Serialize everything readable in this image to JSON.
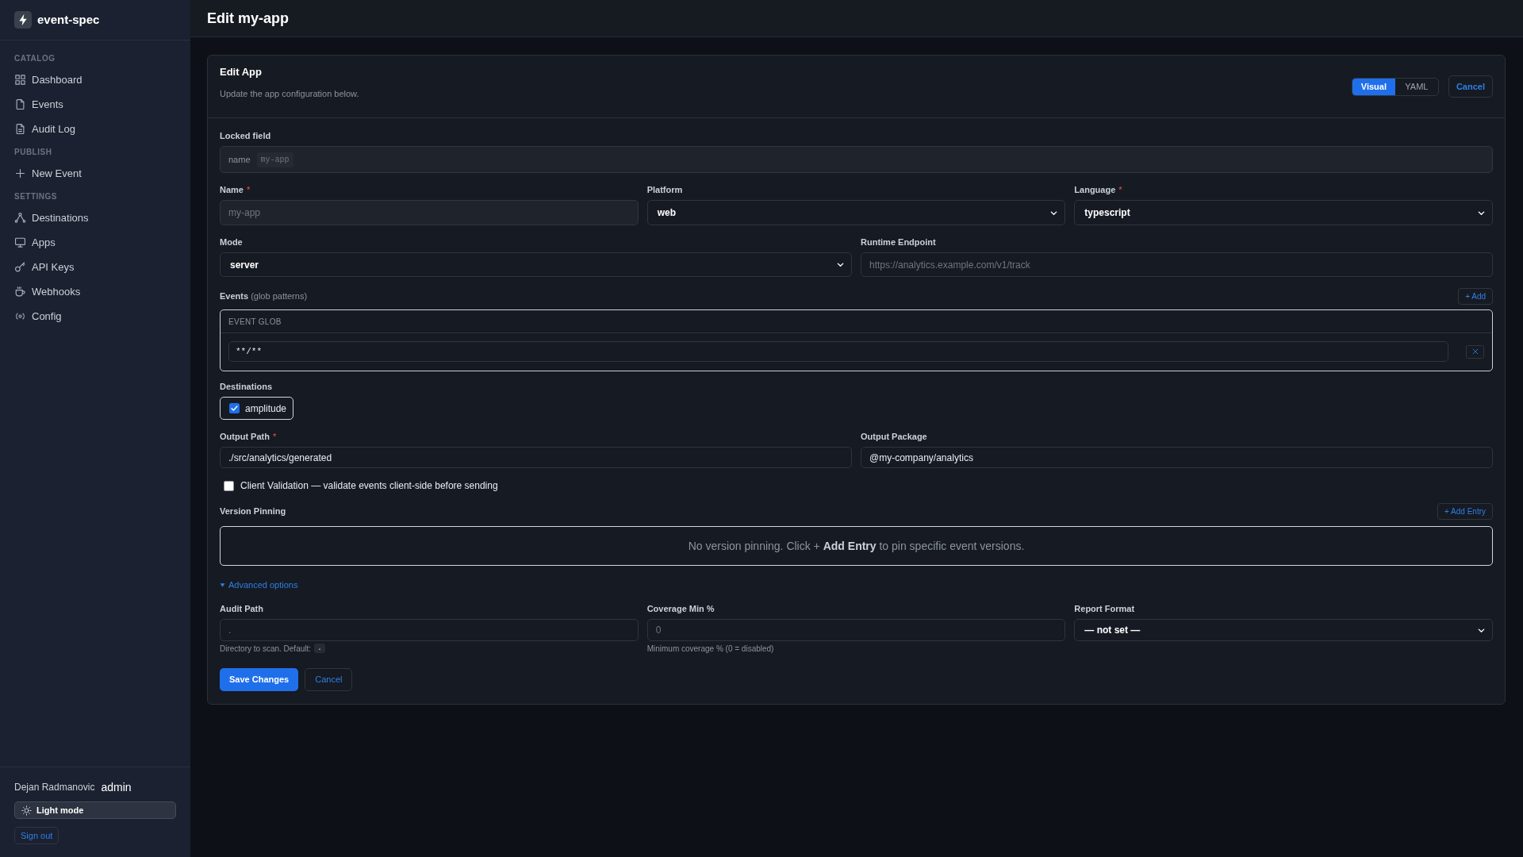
{
  "sidebar": {
    "brand": "event-spec",
    "sections": [
      {
        "label": "CATALOG",
        "items": [
          {
            "label": "Dashboard",
            "selected": false
          },
          {
            "label": "Events",
            "selected": false
          },
          {
            "label": "Audit Log",
            "selected": false
          }
        ]
      },
      {
        "label": "PUBLISH",
        "items": [
          {
            "label": "New Event",
            "selected": false
          }
        ]
      },
      {
        "label": "SETTINGS",
        "items": [
          {
            "label": "Destinations",
            "selected": false
          },
          {
            "label": "Apps",
            "selected": false
          },
          {
            "label": "API Keys",
            "selected": false
          },
          {
            "label": "Webhooks",
            "selected": false
          },
          {
            "label": "Config",
            "selected": false
          }
        ]
      }
    ],
    "user": {
      "name": "Dejan Radmanovic",
      "role": "admin"
    },
    "theme_button": "Light mode",
    "sign_out": "Sign out"
  },
  "page_title": "Edit my-app",
  "form": {
    "title": "Edit App",
    "subtitle": "Update the app configuration below.",
    "view_tabs": [
      {
        "label": "Visual",
        "selected": true
      },
      {
        "label": "YAML",
        "selected": false
      }
    ],
    "cancel_top": "Cancel",
    "locked_field": {
      "label": "Locked field",
      "key": "name",
      "value": "my-app"
    },
    "field_rows": [
      {
        "fields": [
          {
            "kind": "text",
            "label": "Name",
            "required_mark": "*",
            "value": "my-app",
            "disabled": true
          },
          {
            "kind": "select",
            "label": "Platform",
            "value": "web",
            "disabled": false
          },
          {
            "kind": "select",
            "label": "Language",
            "required_mark": "*",
            "value": "typescript",
            "disabled": false
          }
        ]
      },
      {
        "fields": [
          {
            "kind": "select",
            "label": "Mode",
            "value": "server",
            "disabled": false
          },
          {
            "kind": "text",
            "label": "Runtime Endpoint",
            "placeholder": "https://analytics.example.com/v1/track",
            "disabled": false
          }
        ]
      }
    ],
    "events": {
      "label": "**Events** (glob patterns)",
      "add_button": "+ Add",
      "column": "EVENT GLOB",
      "rows": [
        {
          "value": "**/**"
        }
      ]
    },
    "destinations": {
      "label": "Destinations",
      "options": [
        {
          "label": "amplitude",
          "checked": true
        }
      ]
    },
    "output_row": {
      "fields": [
        {
          "kind": "text",
          "label": "Output Path",
          "required_mark": "*",
          "value": "./src/analytics/generated",
          "disabled": false
        },
        {
          "kind": "text",
          "label": "Output Package",
          "value": "@my-company/analytics",
          "disabled": false
        }
      ]
    },
    "client_validation": {
      "label": "Client Validation — validate events client-side before sending",
      "checked": false
    },
    "version_pinning": {
      "label": "Version Pinning",
      "add_button": "+ Add Entry",
      "empty_text": "No version pinning. Click + **Add Entry** to pin specific event versions."
    },
    "advanced": {
      "toggle": "Advanced options",
      "expanded": true,
      "fields": [
        {
          "kind": "text",
          "label": "Audit Path",
          "placeholder": ".",
          "hint": "Directory to scan. Default:",
          "hint_code": ".",
          "disabled": false
        },
        {
          "kind": "text",
          "label": "Coverage Min %",
          "placeholder": "0",
          "hint": "Minimum coverage % (0 = disabled)",
          "disabled": false
        },
        {
          "kind": "select",
          "label": "Report Format",
          "value": "— not set —",
          "disabled": false
        }
      ]
    },
    "actions": {
      "save": "Save Changes",
      "cancel": "Cancel"
    }
  }
}
